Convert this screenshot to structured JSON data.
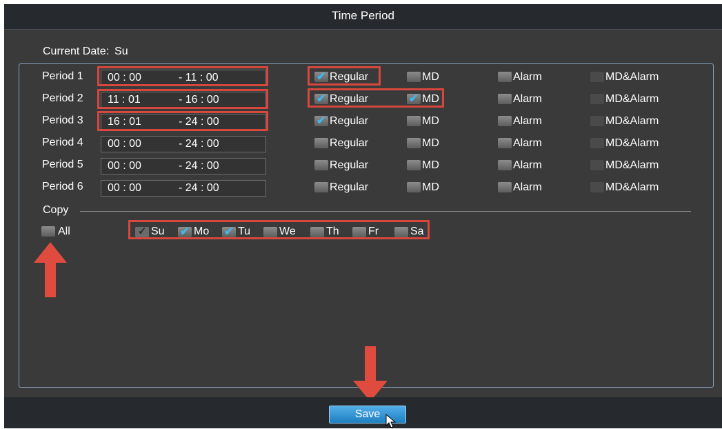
{
  "title": "Time Period",
  "current_date": {
    "label": "Current Date:",
    "value": "Su"
  },
  "periods": [
    {
      "label": "Period 1",
      "start": "00 : 00",
      "end": "- 11 : 00",
      "regular": true,
      "md": false,
      "alarm": false,
      "md_alarm": false
    },
    {
      "label": "Period 2",
      "start": "11 : 01",
      "end": "- 16 : 00",
      "regular": true,
      "md": true,
      "alarm": false,
      "md_alarm": false
    },
    {
      "label": "Period 3",
      "start": "16 : 01",
      "end": "- 24 : 00",
      "regular": true,
      "md": false,
      "alarm": false,
      "md_alarm": false
    },
    {
      "label": "Period 4",
      "start": "00 : 00",
      "end": "- 24 : 00",
      "regular": false,
      "md": false,
      "alarm": false,
      "md_alarm": false
    },
    {
      "label": "Period 5",
      "start": "00 : 00",
      "end": "- 24 : 00",
      "regular": false,
      "md": false,
      "alarm": false,
      "md_alarm": false
    },
    {
      "label": "Period 6",
      "start": "00 : 00",
      "end": "- 24 : 00",
      "regular": false,
      "md": false,
      "alarm": false,
      "md_alarm": false
    }
  ],
  "options": {
    "regular": "Regular",
    "md": "MD",
    "alarm": "Alarm",
    "md_alarm": "MD&Alarm"
  },
  "copy": {
    "label": "Copy",
    "all_label": "All",
    "all_checked": false,
    "days": [
      {
        "label": "Su",
        "checked": true,
        "current": true
      },
      {
        "label": "Mo",
        "checked": true
      },
      {
        "label": "Tu",
        "checked": true
      },
      {
        "label": "We",
        "checked": false
      },
      {
        "label": "Th",
        "checked": false
      },
      {
        "label": "Fr",
        "checked": false
      },
      {
        "label": "Sa",
        "checked": false
      }
    ]
  },
  "save_label": "Save",
  "colors": {
    "highlight": "#d6483e",
    "check": "#3fb8f0",
    "button": "#2f8fd0",
    "panel_border": "#8aa3bd"
  }
}
